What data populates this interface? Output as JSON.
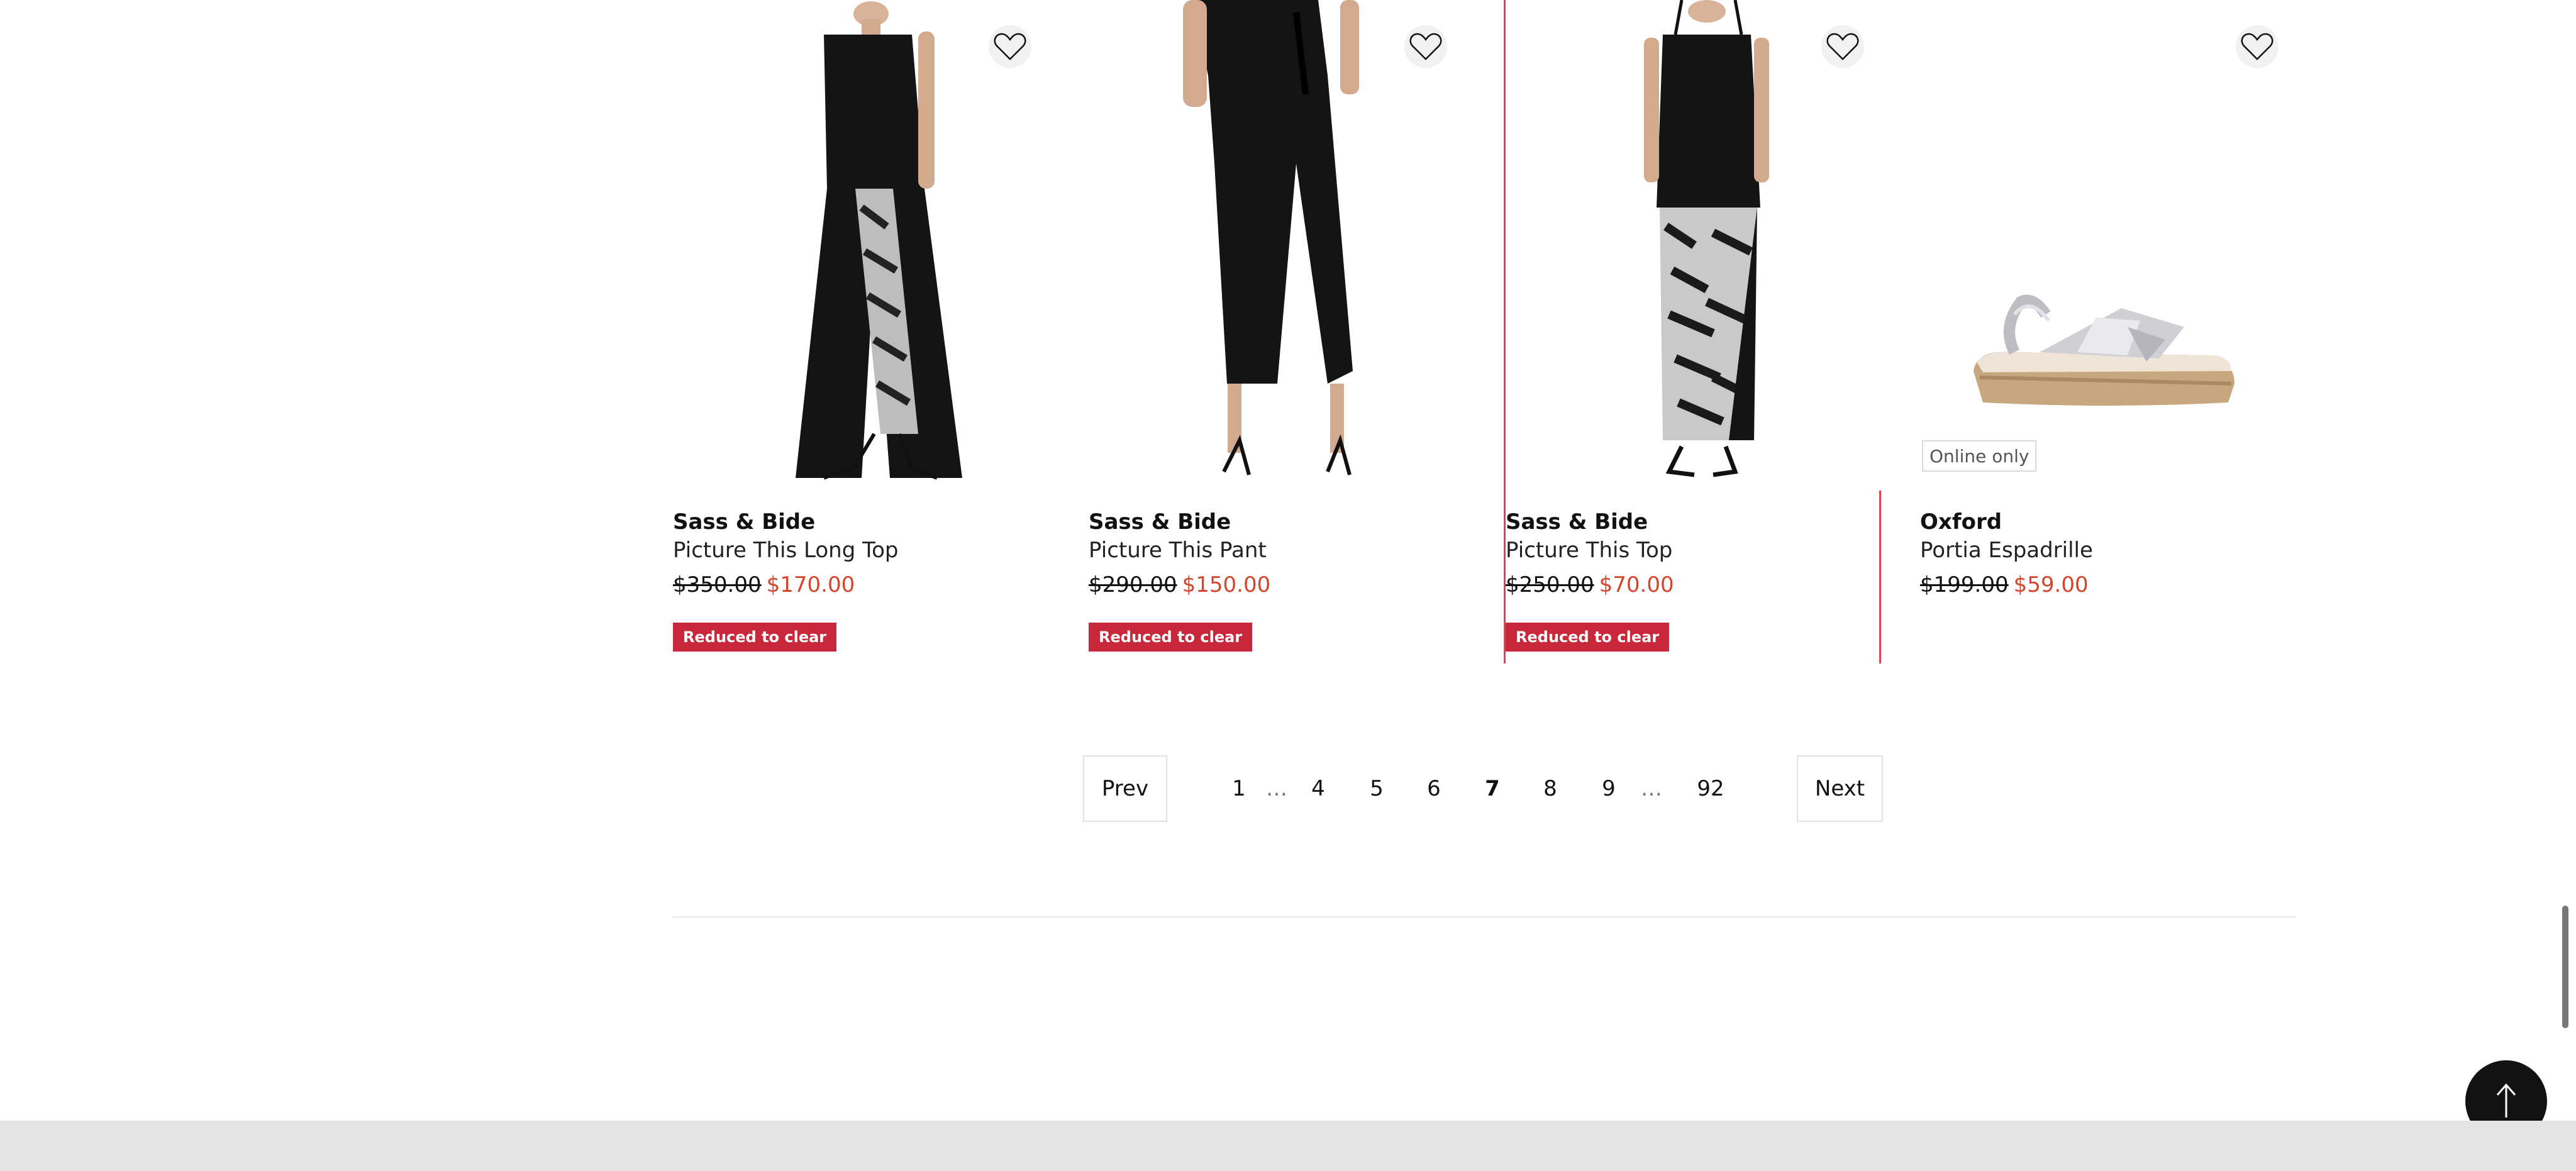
{
  "products": [
    {
      "brand": "Sass & Bide",
      "name": "Picture This Long Top",
      "was": "$350.00",
      "now": "$170.00",
      "badge": "Reduced to clear"
    },
    {
      "brand": "Sass & Bide",
      "name": "Picture This Pant",
      "was": "$290.00",
      "now": "$150.00",
      "badge": "Reduced to clear"
    },
    {
      "brand": "Sass & Bide",
      "name": "Picture This Top",
      "was": "$250.00",
      "now": "$70.00",
      "badge": "Reduced to clear"
    },
    {
      "brand": "Oxford",
      "name": "Portia Espadrille",
      "was": "$199.00",
      "now": "$59.00",
      "tag": "Online only"
    }
  ],
  "pagination": {
    "prev": "Prev",
    "next": "Next",
    "pages": [
      "1",
      "…",
      "4",
      "5",
      "6",
      "7",
      "8",
      "9",
      "…",
      "92"
    ],
    "current": "7"
  },
  "icons": {
    "wishlist": "heart-outline-icon",
    "scroll_top": "arrow-up-icon"
  },
  "colors": {
    "sale_price": "#d4452c",
    "badge_bg": "#c8283a",
    "highlight": "#e0434f"
  }
}
